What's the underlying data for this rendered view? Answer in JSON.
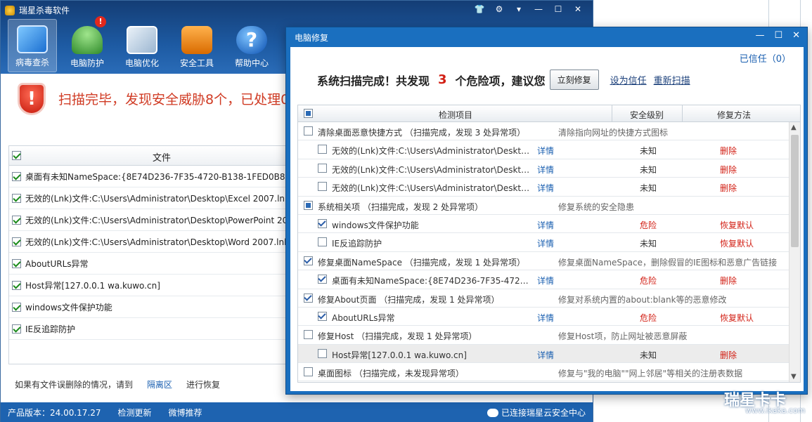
{
  "main": {
    "title": "瑞星杀毒软件",
    "nav": [
      {
        "label": "病毒查杀",
        "icon": "monitor-icon"
      },
      {
        "label": "电脑防护",
        "icon": "umbrella-icon",
        "badge": "!"
      },
      {
        "label": "电脑优化",
        "icon": "laptop-wrench-icon"
      },
      {
        "label": "安全工具",
        "icon": "toolbox-icon"
      },
      {
        "label": "帮助中心",
        "icon": "help-icon"
      }
    ],
    "banner": "扫描完毕，发现安全威胁8个，已处理0",
    "file_header": "文件",
    "files": [
      "桌面有未知NameSpace:{8E74D236-7F35-4720-B138-1FED0B85E",
      "无效的(Lnk)文件:C:\\Users\\Administrator\\Desktop\\Excel 2007.lnk",
      "无效的(Lnk)文件:C:\\Users\\Administrator\\Desktop\\PowerPoint 20",
      "无效的(Lnk)文件:C:\\Users\\Administrator\\Desktop\\Word 2007.lnk",
      "AboutURLs异常",
      "Host异常[127.0.0.1  wa.kuwo.cn]",
      "windows文件保护功能",
      "IE反追踪防护"
    ],
    "bottom": {
      "text": "如果有文件误删除的情况，请到",
      "quarantine": "隔离区",
      "restore": "进行恢复"
    },
    "status": {
      "version": "产品版本：24.00.17.27",
      "update": "检测更新",
      "weibo": "微博推荐",
      "cloud": "已连接瑞星云安全中心"
    }
  },
  "dialog": {
    "title": "电脑修复",
    "trust": "已信任（0）",
    "summary_pre": "系统扫描完成！共发现",
    "count": "3",
    "summary_post": "个危险项，建议您",
    "fix_button": "立刻修复",
    "set_trust": "设为信任",
    "rescan": "重新扫描",
    "columns": {
      "item": "检测项目",
      "level": "安全级别",
      "method": "修复方法"
    },
    "rows": [
      {
        "type": "grp",
        "checked": "off",
        "title": "清除桌面恶意快捷方式 （扫描完成，发现 3 处异常项）",
        "desc": "清除指向网址的快捷方式图标"
      },
      {
        "type": "child",
        "checked": "off",
        "title": "无效的(Lnk)文件:C:\\Users\\Administrator\\Desktop\\Excel 2007.lnk",
        "detail": "详情",
        "level": "未知",
        "action": "删除",
        "lvl_red": false,
        "act_red": true
      },
      {
        "type": "child",
        "checked": "off",
        "title": "无效的(Lnk)文件:C:\\Users\\Administrator\\Desktop\\PowerPoint 2007.lnk",
        "detail": "详情",
        "level": "未知",
        "action": "删除",
        "lvl_red": false,
        "act_red": true
      },
      {
        "type": "child",
        "checked": "off",
        "title": "无效的(Lnk)文件:C:\\Users\\Administrator\\Desktop\\Word 2007.lnk",
        "detail": "详情",
        "level": "未知",
        "action": "删除",
        "lvl_red": false,
        "act_red": true
      },
      {
        "type": "grp",
        "checked": "part",
        "title": "系统相关项 （扫描完成，发现 2 处异常项）",
        "desc": "修复系统的安全隐患"
      },
      {
        "type": "child",
        "checked": "on",
        "title": "windows文件保护功能",
        "detail": "详情",
        "level": "危险",
        "action": "恢复默认",
        "lvl_red": true,
        "act_red": true
      },
      {
        "type": "child",
        "checked": "off",
        "title": "IE反追踪防护",
        "detail": "详情",
        "level": "未知",
        "action": "恢复默认",
        "lvl_red": false,
        "act_red": true
      },
      {
        "type": "grp",
        "checked": "on",
        "title": "修复桌面NameSpace （扫描完成，发现 1 处异常项）",
        "desc": "修复桌面NameSpace，删除假冒的IE图标和恶意广告链接"
      },
      {
        "type": "child",
        "checked": "on",
        "title": "桌面有未知NameSpace:{8E74D236-7F35-4720-B138-1FED0B85EA75}",
        "detail": "详情",
        "level": "危险",
        "action": "删除",
        "lvl_red": true,
        "act_red": true
      },
      {
        "type": "grp",
        "checked": "on",
        "title": "修复About页面 （扫描完成，发现 1 处异常项）",
        "desc": "修复对系统内置的about:blank等的恶意修改"
      },
      {
        "type": "child",
        "checked": "on",
        "title": "AboutURLs异常",
        "detail": "详情",
        "level": "危险",
        "action": "恢复默认",
        "lvl_red": true,
        "act_red": true
      },
      {
        "type": "grp",
        "checked": "off",
        "title": "修复Host （扫描完成，发现 1 处异常项）",
        "desc": "修复Host项，防止网址被恶意屏蔽"
      },
      {
        "type": "child",
        "checked": "off",
        "hl": true,
        "title": "Host异常[127.0.0.1 wa.kuwo.cn]",
        "detail": "详情",
        "level": "未知",
        "action": "删除",
        "lvl_red": false,
        "act_red": true
      },
      {
        "type": "grp",
        "checked": "off",
        "title": "桌面图标 （扫描完成，未发现异常项）",
        "desc": "修复与\"我的电脑\"\"网上邻居\"等相关的注册表数据"
      }
    ]
  },
  "watermark": {
    "brand": "瑞星卡卡",
    "url": "www.ikaka.com"
  },
  "colors": {
    "accent": "#1e63b0",
    "danger": "#d21f14",
    "link": "#1a5fb0"
  }
}
